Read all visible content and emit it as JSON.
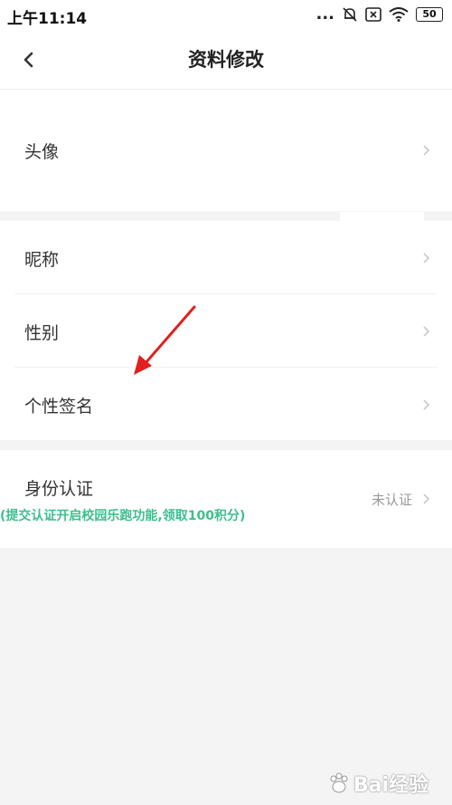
{
  "status_bar": {
    "time": "上午11:14",
    "dots": "...",
    "battery": "50",
    "icons": [
      "bell-off-icon",
      "sim-off-icon",
      "wifi-icon",
      "battery-icon"
    ]
  },
  "header": {
    "title": "资料修改",
    "back_icon": "chevron-left-icon"
  },
  "rows": {
    "avatar": {
      "label": "头像"
    },
    "nickname": {
      "label": "昵称"
    },
    "gender": {
      "label": "性别"
    },
    "signature": {
      "label": "个性签名"
    },
    "identity": {
      "label": "身份认证",
      "value": "未认证",
      "hint": "(提交认证开启校园乐跑功能,领取100积分)"
    }
  },
  "watermark": {
    "text": "Bai经验"
  },
  "colors": {
    "background": "#f4f4f4",
    "hint_green": "#3cbf8c",
    "annotation_arrow": "#e02020"
  }
}
